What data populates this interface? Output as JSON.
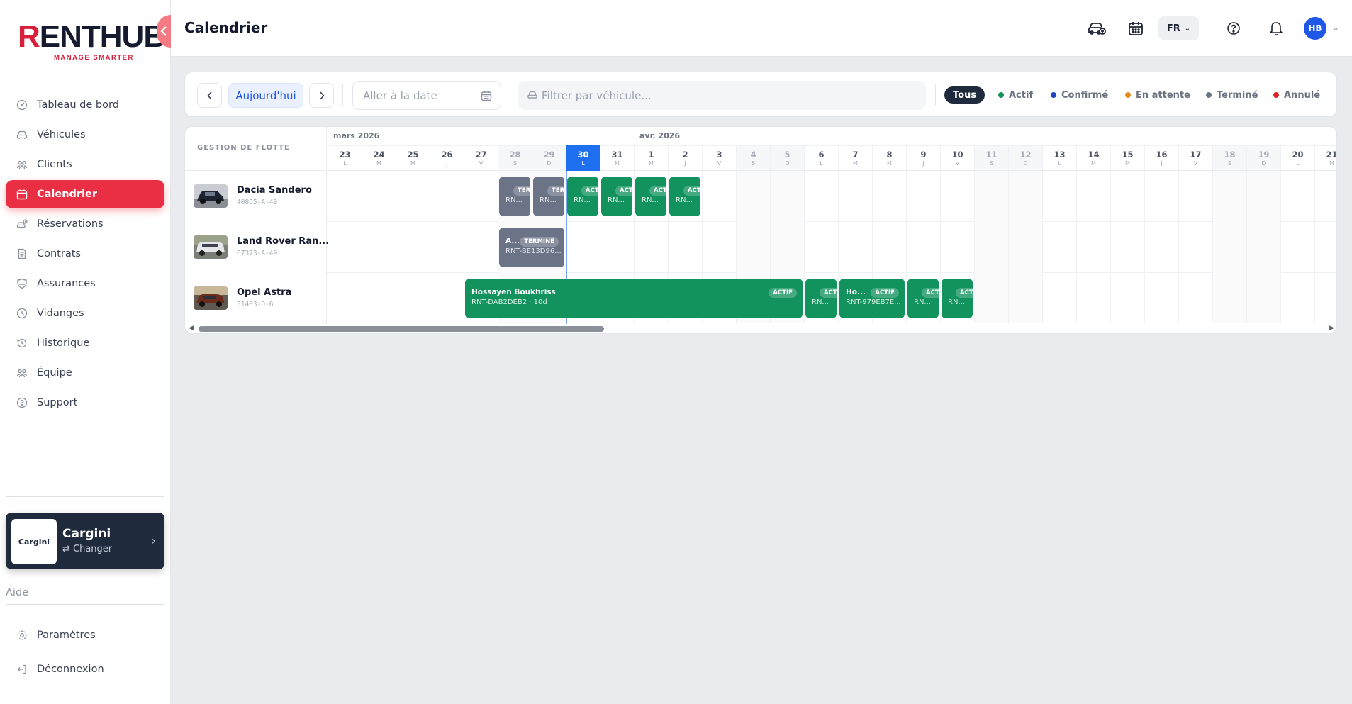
{
  "sidebar": {
    "logo_text_r": "R",
    "logo_text_rest": "ENTHUB",
    "logo_tagline": "MANAGE SMARTER",
    "items": [
      {
        "label": "Tableau de bord",
        "icon": "dashboard-icon"
      },
      {
        "label": "Véhicules",
        "icon": "car-icon"
      },
      {
        "label": "Clients",
        "icon": "users-icon"
      },
      {
        "label": "Calendrier",
        "icon": "calendar-icon",
        "active": true
      },
      {
        "label": "Réservations",
        "icon": "bookings-icon"
      },
      {
        "label": "Contrats",
        "icon": "document-icon"
      },
      {
        "label": "Assurances",
        "icon": "insurance-icon"
      },
      {
        "label": "Vidanges",
        "icon": "oil-icon"
      },
      {
        "label": "Historique",
        "icon": "history-icon"
      },
      {
        "label": "Équipe",
        "icon": "team-icon"
      },
      {
        "label": "Support",
        "icon": "help-icon"
      }
    ],
    "workspace": {
      "logo": "Cargini",
      "name": "Cargini",
      "change_label": "⇄ Changer"
    },
    "help_label": "Aide",
    "bottom_items": [
      {
        "label": "Paramètres",
        "icon": "settings-icon"
      },
      {
        "label": "Déconnexion",
        "icon": "logout-icon"
      }
    ]
  },
  "header": {
    "title": "Calendrier",
    "language": "FR",
    "avatar_initials": "HB"
  },
  "toolbar": {
    "today_label": "Aujourd'hui",
    "date_placeholder": "Aller à la date",
    "vehicle_filter_placeholder": "Filtrer par véhicule...",
    "statuses": [
      {
        "label": "Tous",
        "selected": true
      },
      {
        "label": "Actif",
        "color": "#12935e"
      },
      {
        "label": "Confirmé",
        "color": "#1f47c4"
      },
      {
        "label": "En attente",
        "color": "#e8891b"
      },
      {
        "label": "Terminé",
        "color": "#6b7386"
      },
      {
        "label": "Annulé",
        "color": "#dc2626"
      }
    ]
  },
  "calendar": {
    "fleet_header": "GESTION DE FLOTTE",
    "months": [
      {
        "label": "mars 2026",
        "start_index": 0
      },
      {
        "label": "avr. 2026",
        "start_index": 9
      }
    ],
    "days": [
      {
        "n": "23",
        "w": "L"
      },
      {
        "n": "24",
        "w": "M"
      },
      {
        "n": "25",
        "w": "M"
      },
      {
        "n": "26",
        "w": "J"
      },
      {
        "n": "27",
        "w": "V"
      },
      {
        "n": "28",
        "w": "S",
        "weekend": true
      },
      {
        "n": "29",
        "w": "D",
        "weekend": true
      },
      {
        "n": "30",
        "w": "L",
        "today": true
      },
      {
        "n": "31",
        "w": "M"
      },
      {
        "n": "1",
        "w": "M"
      },
      {
        "n": "2",
        "w": "J"
      },
      {
        "n": "3",
        "w": "V"
      },
      {
        "n": "4",
        "w": "S",
        "weekend": true
      },
      {
        "n": "5",
        "w": "D",
        "weekend": true
      },
      {
        "n": "6",
        "w": "L"
      },
      {
        "n": "7",
        "w": "M"
      },
      {
        "n": "8",
        "w": "M"
      },
      {
        "n": "9",
        "w": "J"
      },
      {
        "n": "10",
        "w": "V"
      },
      {
        "n": "11",
        "w": "S",
        "weekend": true
      },
      {
        "n": "12",
        "w": "D",
        "weekend": true
      },
      {
        "n": "13",
        "w": "L"
      },
      {
        "n": "14",
        "w": "M"
      },
      {
        "n": "15",
        "w": "M"
      },
      {
        "n": "16",
        "w": "J"
      },
      {
        "n": "17",
        "w": "V"
      },
      {
        "n": "18",
        "w": "S",
        "weekend": true
      },
      {
        "n": "19",
        "w": "D",
        "weekend": true
      },
      {
        "n": "20",
        "w": "L"
      },
      {
        "n": "21",
        "w": "M"
      }
    ],
    "vehicles": [
      {
        "name": "Dacia Sandero",
        "plate": "40855-A-49",
        "bookings": [
          {
            "start": 5,
            "days": 1,
            "status": "gray",
            "name": "",
            "badge": "TERM",
            "ref": "RN..."
          },
          {
            "start": 6,
            "days": 1,
            "status": "gray",
            "name": "",
            "badge": "TERM",
            "ref": "RN..."
          },
          {
            "start": 7,
            "days": 1,
            "status": "green",
            "name": "",
            "badge": "ACTI",
            "ref": "RN..."
          },
          {
            "start": 8,
            "days": 1,
            "status": "green",
            "name": "",
            "badge": "ACTI",
            "ref": "RN..."
          },
          {
            "start": 9,
            "days": 1,
            "status": "green",
            "name": "",
            "badge": "ACTI",
            "ref": "RN..."
          },
          {
            "start": 10,
            "days": 1,
            "status": "green",
            "name": "",
            "badge": "ACTI",
            "ref": "RN..."
          }
        ]
      },
      {
        "name": "Land Rover Ran...",
        "plate": "67373-A-49",
        "bookings": [
          {
            "start": 5,
            "days": 2,
            "status": "gray",
            "name": "A...",
            "badge": "TERMINÉ",
            "ref": "RNT-BE13D96..."
          }
        ]
      },
      {
        "name": "Opel Astra",
        "plate": "51403-D-6",
        "bookings": [
          {
            "start": 4,
            "days": 10,
            "status": "green",
            "name": "Hossayen Boukhriss",
            "badge": "ACTIF",
            "ref": "RNT-DAB2DEB2 · 10d"
          },
          {
            "start": 14,
            "days": 1,
            "status": "green",
            "name": "",
            "badge": "ACTI",
            "ref": "RN..."
          },
          {
            "start": 15,
            "days": 2,
            "status": "green",
            "name": "Ho...",
            "badge": "ACTIF",
            "ref": "RNT-979EB7E..."
          },
          {
            "start": 17,
            "days": 1,
            "status": "green",
            "name": "",
            "badge": "ACTI",
            "ref": "RN..."
          },
          {
            "start": 18,
            "days": 1,
            "status": "green",
            "name": "",
            "badge": "ACTI",
            "ref": "RN..."
          }
        ]
      }
    ],
    "scroll_fraction": 0.36
  }
}
